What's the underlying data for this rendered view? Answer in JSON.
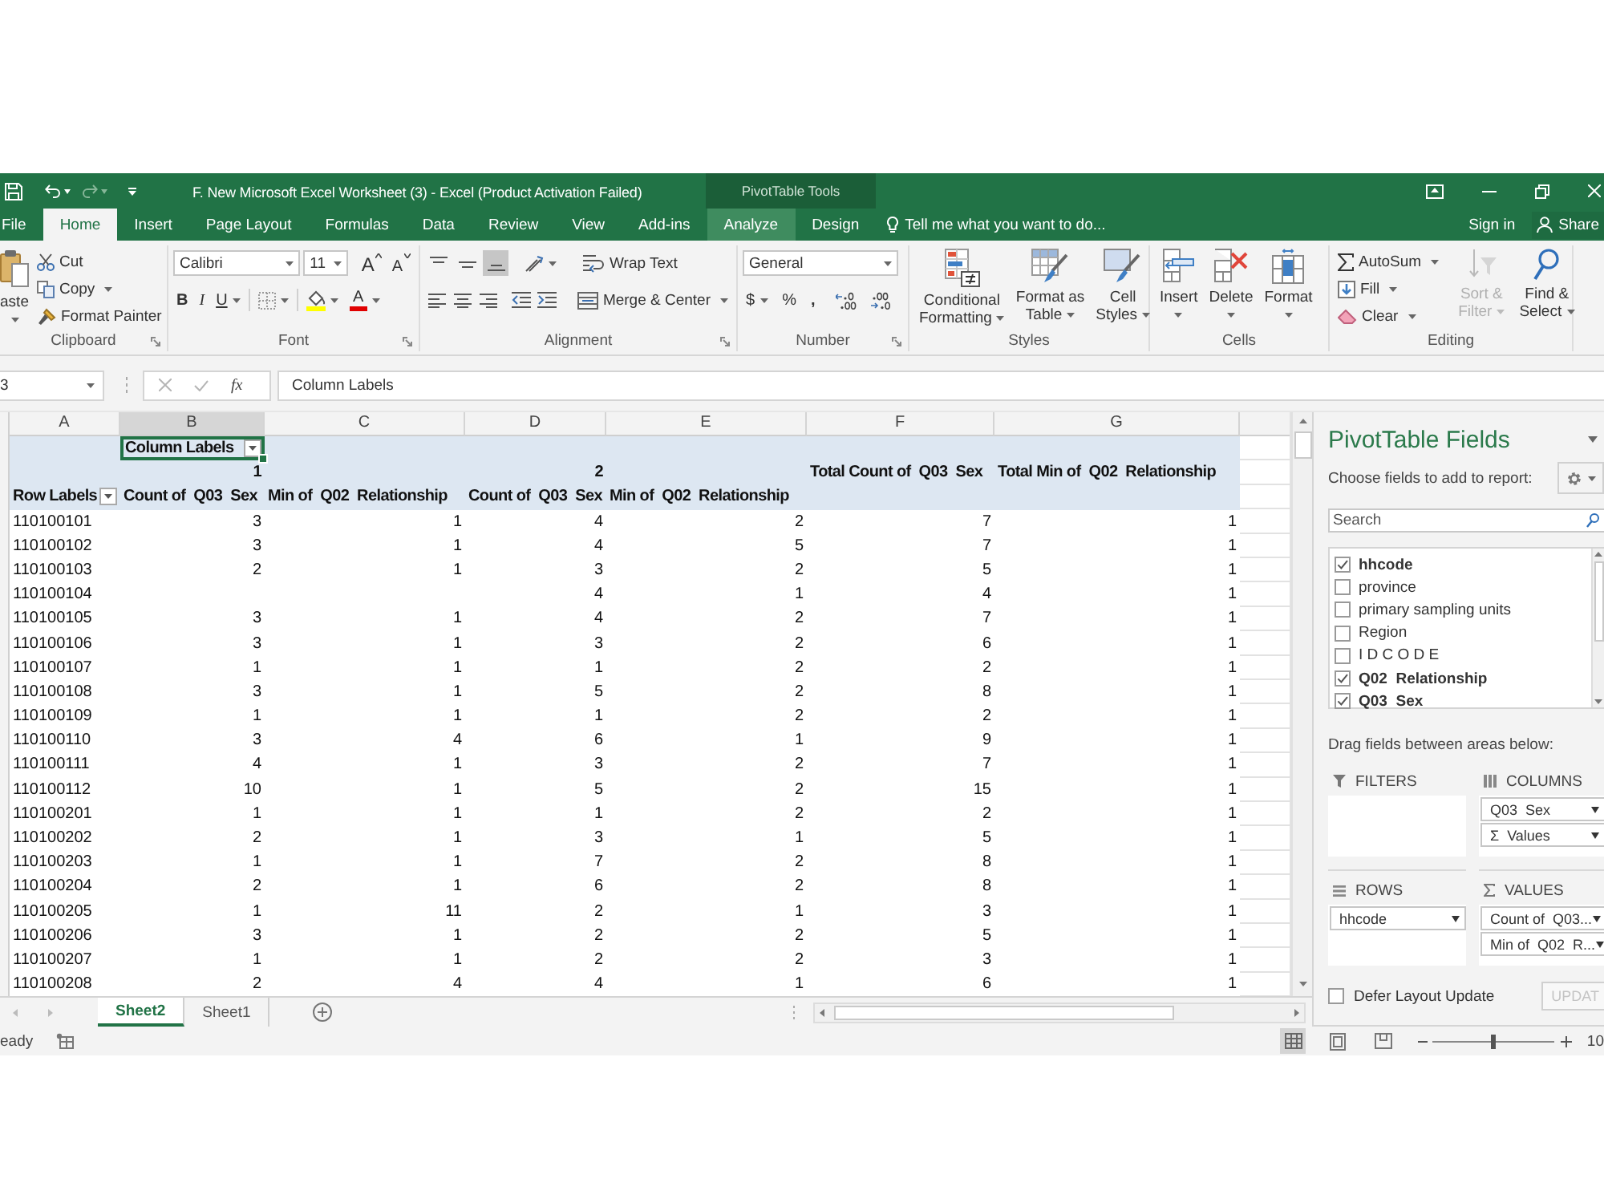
{
  "title_bar": {
    "title": "F. New Microsoft Excel Worksheet (3) - Excel (Product Activation Failed)",
    "contextual_label": "PivotTable Tools"
  },
  "ribbon_tabs": [
    {
      "label": "File",
      "selected": false,
      "hovered": false
    },
    {
      "label": "Home",
      "selected": true,
      "hovered": false
    },
    {
      "label": "Insert",
      "selected": false,
      "hovered": false
    },
    {
      "label": "Page Layout",
      "selected": false,
      "hovered": false
    },
    {
      "label": "Formulas",
      "selected": false,
      "hovered": false
    },
    {
      "label": "Data",
      "selected": false,
      "hovered": false
    },
    {
      "label": "Review",
      "selected": false,
      "hovered": false
    },
    {
      "label": "View",
      "selected": false,
      "hovered": false
    },
    {
      "label": "Add-ins",
      "selected": false,
      "hovered": false
    },
    {
      "label": "Analyze",
      "selected": false,
      "hovered": true
    },
    {
      "label": "Design",
      "selected": false,
      "hovered": false
    }
  ],
  "tell_me": {
    "placeholder": "Tell me what you want to do..."
  },
  "account": {
    "sign_in": "Sign in",
    "share": "Share"
  },
  "ribbon_groups": [
    {
      "kind": "clipboard",
      "label": "Clipboard",
      "launcher": true,
      "paste": {
        "label": "aste",
        "dropdown": true
      },
      "commands": [
        {
          "label": "Cut",
          "dropdown": false
        },
        {
          "label": "Copy",
          "dropdown": true
        },
        {
          "label": "Format Painter",
          "dropdown": false
        }
      ]
    },
    {
      "kind": "font",
      "label": "Font",
      "launcher": true,
      "font_name": "Calibri",
      "font_size": "11",
      "grow_label": "A",
      "shrink_label": "A",
      "styles": [
        {
          "label": "B"
        },
        {
          "label": "I"
        },
        {
          "label": "U"
        }
      ],
      "font_color_label": "A"
    },
    {
      "kind": "alignment",
      "label": "Alignment",
      "launcher": true,
      "vertical": [
        {
          "selected": false
        },
        {
          "selected": false
        },
        {
          "selected": true
        }
      ],
      "horizontal": [
        {
          "selected": false
        },
        {
          "selected": false
        },
        {
          "selected": false
        }
      ],
      "wrap_label": "Wrap Text",
      "merge_label": "Merge & Center"
    },
    {
      "kind": "number",
      "label": "Number",
      "launcher": true,
      "format": "General",
      "currency": "$",
      "percent": "%",
      "comma": ","
    },
    {
      "kind": "styles",
      "label": "Styles",
      "launcher": false,
      "commands": [
        {
          "lines": [
            "Conditional",
            "Formatting"
          ]
        },
        {
          "lines": [
            "Format as",
            "Table"
          ]
        },
        {
          "lines": [
            "Cell",
            "Styles"
          ]
        }
      ]
    },
    {
      "kind": "cells",
      "label": "Cells",
      "launcher": false,
      "commands": [
        {
          "label": "Insert"
        },
        {
          "label": "Delete"
        },
        {
          "label": "Format"
        }
      ]
    },
    {
      "kind": "editing",
      "label": "Editing",
      "launcher": false,
      "commands": [
        {
          "label": "AutoSum",
          "dropdown": true
        },
        {
          "label": "Fill",
          "dropdown": true
        },
        {
          "label": "Clear",
          "dropdown": true
        }
      ],
      "large": [
        {
          "lines": [
            "Sort &",
            "Filter"
          ],
          "disabled": true
        },
        {
          "lines": [
            "Find &",
            "Select"
          ],
          "disabled": false
        }
      ]
    }
  ],
  "formula_bar": {
    "name_box": "3",
    "function_label": "fx",
    "value": "Column Labels"
  },
  "sheet": {
    "columns": [
      {
        "label": "A",
        "selected": false
      },
      {
        "label": "B",
        "selected": true
      },
      {
        "label": "C",
        "selected": false
      },
      {
        "label": "D",
        "selected": false
      },
      {
        "label": "E",
        "selected": false
      },
      {
        "label": "F",
        "selected": false
      },
      {
        "label": "G",
        "selected": false
      }
    ],
    "column_labels": {
      "label": "Column Labels",
      "selected": true
    },
    "value_groups": [
      {
        "label": "1"
      },
      {
        "label": "2"
      }
    ],
    "grand_total_headers": [
      "Total Count of  Q03  Sex",
      "Total Min of  Q02  Relationship"
    ],
    "row_labels": "Row Labels",
    "value_headers": [
      "Count of  Q03  Sex",
      "Min of  Q02  Relationship",
      "Count of  Q03  Sex",
      "Min of  Q02  Relationship"
    ],
    "rows": [
      {
        "label": "110100101",
        "count_1": "3",
        "min_1": "1",
        "count_2": "4",
        "min_2": "2",
        "total_count": "7",
        "total_min": "1"
      },
      {
        "label": "110100102",
        "count_1": "3",
        "min_1": "1",
        "count_2": "4",
        "min_2": "5",
        "total_count": "7",
        "total_min": "1"
      },
      {
        "label": "110100103",
        "count_1": "2",
        "min_1": "1",
        "count_2": "3",
        "min_2": "2",
        "total_count": "5",
        "total_min": "1"
      },
      {
        "label": "110100104",
        "count_2": "4",
        "min_2": "1",
        "total_count": "4",
        "total_min": "1"
      },
      {
        "label": "110100105",
        "count_1": "3",
        "min_1": "1",
        "count_2": "4",
        "min_2": "2",
        "total_count": "7",
        "total_min": "1"
      },
      {
        "label": "110100106",
        "count_1": "3",
        "min_1": "1",
        "count_2": "3",
        "min_2": "2",
        "total_count": "6",
        "total_min": "1"
      },
      {
        "label": "110100107",
        "count_1": "1",
        "min_1": "1",
        "count_2": "1",
        "min_2": "2",
        "total_count": "2",
        "total_min": "1"
      },
      {
        "label": "110100108",
        "count_1": "3",
        "min_1": "1",
        "count_2": "5",
        "min_2": "2",
        "total_count": "8",
        "total_min": "1"
      },
      {
        "label": "110100109",
        "count_1": "1",
        "min_1": "1",
        "count_2": "1",
        "min_2": "2",
        "total_count": "2",
        "total_min": "1"
      },
      {
        "label": "110100110",
        "count_1": "3",
        "min_1": "4",
        "count_2": "6",
        "min_2": "1",
        "total_count": "9",
        "total_min": "1"
      },
      {
        "label": "110100111",
        "count_1": "4",
        "min_1": "1",
        "count_2": "3",
        "min_2": "2",
        "total_count": "7",
        "total_min": "1"
      },
      {
        "label": "110100112",
        "count_1": "10",
        "min_1": "1",
        "count_2": "5",
        "min_2": "2",
        "total_count": "15",
        "total_min": "1"
      },
      {
        "label": "110100201",
        "count_1": "1",
        "min_1": "1",
        "count_2": "1",
        "min_2": "2",
        "total_count": "2",
        "total_min": "1"
      },
      {
        "label": "110100202",
        "count_1": "2",
        "min_1": "1",
        "count_2": "3",
        "min_2": "1",
        "total_count": "5",
        "total_min": "1"
      },
      {
        "label": "110100203",
        "count_1": "1",
        "min_1": "1",
        "count_2": "7",
        "min_2": "2",
        "total_count": "8",
        "total_min": "1"
      },
      {
        "label": "110100204",
        "count_1": "2",
        "min_1": "1",
        "count_2": "6",
        "min_2": "2",
        "total_count": "8",
        "total_min": "1"
      },
      {
        "label": "110100205",
        "count_1": "1",
        "min_1": "11",
        "count_2": "2",
        "min_2": "1",
        "total_count": "3",
        "total_min": "1"
      },
      {
        "label": "110100206",
        "count_1": "3",
        "min_1": "1",
        "count_2": "2",
        "min_2": "2",
        "total_count": "5",
        "total_min": "1"
      },
      {
        "label": "110100207",
        "count_1": "1",
        "min_1": "1",
        "count_2": "2",
        "min_2": "2",
        "total_count": "3",
        "total_min": "1"
      },
      {
        "label": "110100208",
        "count_1": "2",
        "min_1": "4",
        "count_2": "4",
        "min_2": "1",
        "total_count": "6",
        "total_min": "1"
      }
    ]
  },
  "sheet_tabs": [
    {
      "label": "Sheet2",
      "selected": true
    },
    {
      "label": "Sheet1",
      "selected": false
    }
  ],
  "pivot_fields_panel": {
    "title": "PivotTable Fields",
    "subtitle": "Choose fields to add to report:",
    "search": {
      "placeholder": "Search"
    },
    "fields": [
      {
        "label": "hhcode",
        "checked": true
      },
      {
        "label": "province",
        "checked": false
      },
      {
        "label": "primary sampling units",
        "checked": false
      },
      {
        "label": "Region",
        "checked": false
      },
      {
        "label": "I D C O D E",
        "checked": false
      },
      {
        "label": "Q02  Relationship",
        "checked": true
      },
      {
        "label": "Q03  Sex",
        "checked": true
      }
    ],
    "areas_hint": "Drag fields between areas below:",
    "areas": [
      {
        "kind": "filters",
        "label": "FILTERS"
      },
      {
        "kind": "columns",
        "label": "COLUMNS",
        "items": [
          "Q03  Sex",
          "Σ  Values"
        ]
      },
      {
        "kind": "rows",
        "label": "ROWS",
        "items": [
          "hhcode"
        ]
      },
      {
        "kind": "values",
        "label": "VALUES",
        "items": [
          "Count of  Q03...",
          "Min of  Q02  R..."
        ]
      }
    ],
    "defer_update": {
      "label": "Defer Layout Update",
      "checked": false
    },
    "update_button": {
      "label": "UPDAT",
      "disabled": true
    }
  },
  "status_bar": {
    "status": "eady",
    "views": [
      {
        "kind": "normal",
        "selected": true
      },
      {
        "kind": "page_layout",
        "selected": false
      },
      {
        "kind": "page_break",
        "selected": false
      }
    ],
    "zoom": {
      "level": 0.5,
      "label": "10"
    }
  }
}
